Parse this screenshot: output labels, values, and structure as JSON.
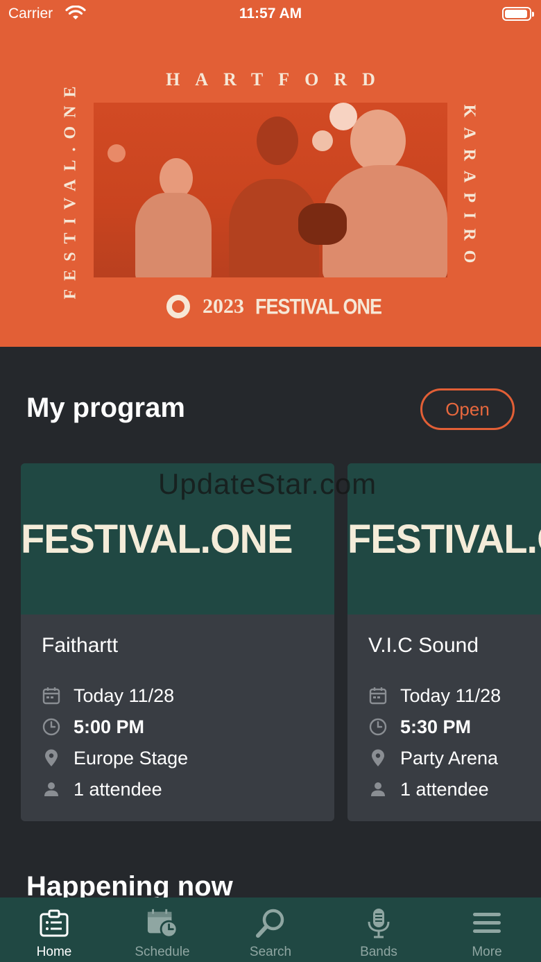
{
  "status_bar": {
    "carrier": "Carrier",
    "time": "11:57 AM"
  },
  "hero": {
    "top_word": "HARTFORD",
    "left_vertical": "FESTIVAL.ONE",
    "right_vertical": "KARAPIRO",
    "year": "2023",
    "brand": "FESTIVAL ONE",
    "colors": {
      "background": "#e25f36",
      "text": "#f6e7d6"
    }
  },
  "my_program": {
    "title": "My program",
    "open_label": "Open",
    "cards": [
      {
        "banner": "FESTIVAL.ONE",
        "title": "Faithartt",
        "date": "Today 11/28",
        "time": "5:00 PM",
        "location": "Europe Stage",
        "attendees": "1 attendee"
      },
      {
        "banner": "FESTIVAL.ONE",
        "title": "V.I.C Sound",
        "date": "Today 11/28",
        "time": "5:30 PM",
        "location": "Party Arena",
        "attendees": "1 attendee"
      }
    ]
  },
  "watermark": "UpdateStar.com",
  "happening_now": {
    "title": "Happening now"
  },
  "tabbar": {
    "tabs": [
      {
        "label": "Home",
        "icon": "home-clipboard-icon",
        "active": true
      },
      {
        "label": "Schedule",
        "icon": "calendar-clock-icon",
        "active": false
      },
      {
        "label": "Search",
        "icon": "search-icon",
        "active": false
      },
      {
        "label": "Bands",
        "icon": "microphone-icon",
        "active": false
      },
      {
        "label": "More",
        "icon": "hamburger-menu-icon",
        "active": false
      }
    ]
  },
  "colors": {
    "page_background": "#25282c",
    "card_background": "#393d43",
    "accent": "#e25f36",
    "teal": "#204843"
  }
}
